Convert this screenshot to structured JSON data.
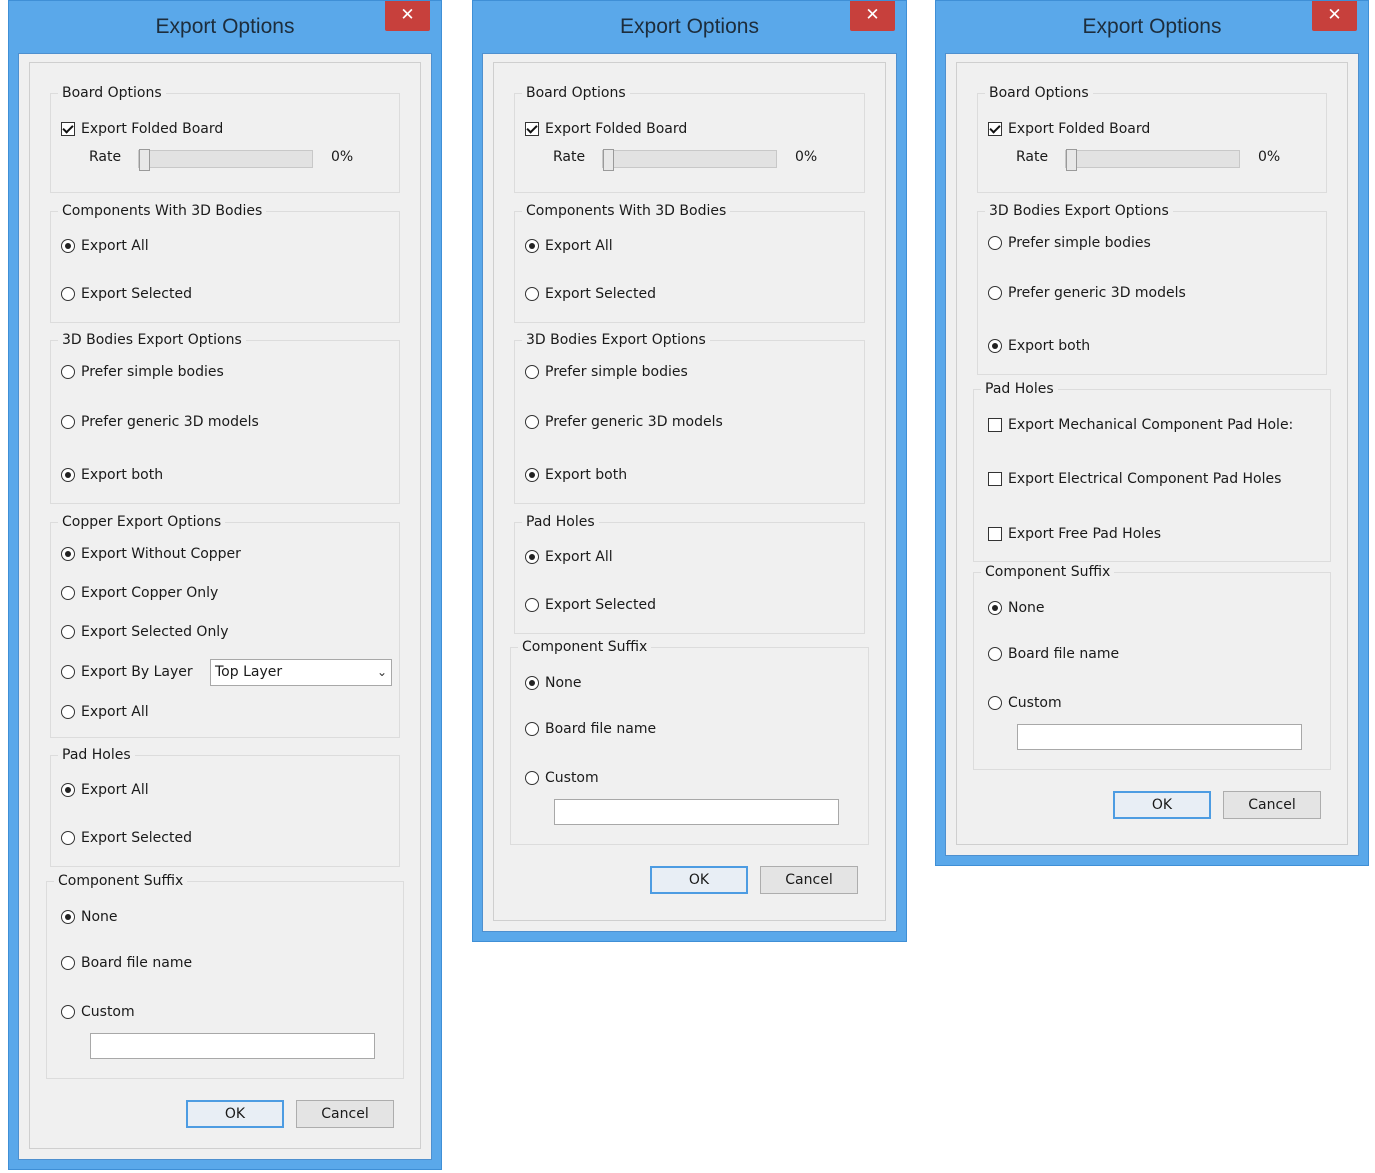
{
  "dialogs": [
    {
      "title": "Export Options",
      "close_glyph": "✕",
      "board_options": {
        "title": "Board Options",
        "export_folded_board": "Export Folded Board",
        "rate_label": "Rate",
        "rate_value": "0%",
        "rate_fraction": 0
      },
      "components_3d": {
        "title": "Components With 3D Bodies",
        "options": [
          "Export All",
          "Export Selected"
        ],
        "selected": 0
      },
      "bodies_export": {
        "title": "3D Bodies Export Options",
        "options": [
          "Prefer simple bodies",
          "Prefer generic 3D models",
          "Export both"
        ],
        "selected": 2
      },
      "copper_export": {
        "title": "Copper Export Options",
        "options": [
          "Export Without Copper",
          "Export Copper Only",
          "Export Selected Only",
          "Export By Layer",
          "Export All"
        ],
        "selected": 0,
        "layer_select": "Top Layer"
      },
      "pad_holes": {
        "title": "Pad Holes",
        "options": [
          "Export All",
          "Export Selected"
        ],
        "selected": 0
      },
      "component_suffix": {
        "title": "Component Suffix",
        "options": [
          "None",
          "Board file name",
          "Custom"
        ],
        "selected": 0,
        "custom_value": ""
      },
      "ok": "OK",
      "cancel": "Cancel"
    },
    {
      "title": "Export Options",
      "close_glyph": "✕",
      "board_options": {
        "title": "Board Options",
        "export_folded_board": "Export Folded Board",
        "rate_label": "Rate",
        "rate_value": "0%",
        "rate_fraction": 0
      },
      "components_3d": {
        "title": "Components With 3D Bodies",
        "options": [
          "Export All",
          "Export Selected"
        ],
        "selected": 0
      },
      "bodies_export": {
        "title": "3D Bodies Export Options",
        "options": [
          "Prefer simple bodies",
          "Prefer generic 3D models",
          "Export both"
        ],
        "selected": 2
      },
      "pad_holes": {
        "title": "Pad Holes",
        "options": [
          "Export All",
          "Export Selected"
        ],
        "selected": 0
      },
      "component_suffix": {
        "title": "Component Suffix",
        "options": [
          "None",
          "Board file name",
          "Custom"
        ],
        "selected": 0,
        "custom_value": ""
      },
      "ok": "OK",
      "cancel": "Cancel"
    },
    {
      "title": "Export Options",
      "close_glyph": "✕",
      "board_options": {
        "title": "Board Options",
        "export_folded_board": "Export Folded Board",
        "rate_label": "Rate",
        "rate_value": "0%",
        "rate_fraction": 0
      },
      "bodies_export": {
        "title": "3D Bodies Export Options",
        "options": [
          "Prefer simple bodies",
          "Prefer generic 3D models",
          "Export both"
        ],
        "selected": 2
      },
      "pad_holes": {
        "title": "Pad Holes",
        "checkboxes": [
          "Export Mechanical Component Pad Hole:",
          "Export Electrical Component Pad Holes",
          "Export Free Pad Holes"
        ],
        "checked": [
          false,
          false,
          false
        ]
      },
      "component_suffix": {
        "title": "Component Suffix",
        "options": [
          "None",
          "Board file name",
          "Custom"
        ],
        "selected": 0,
        "custom_value": ""
      },
      "ok": "OK",
      "cancel": "Cancel"
    }
  ]
}
